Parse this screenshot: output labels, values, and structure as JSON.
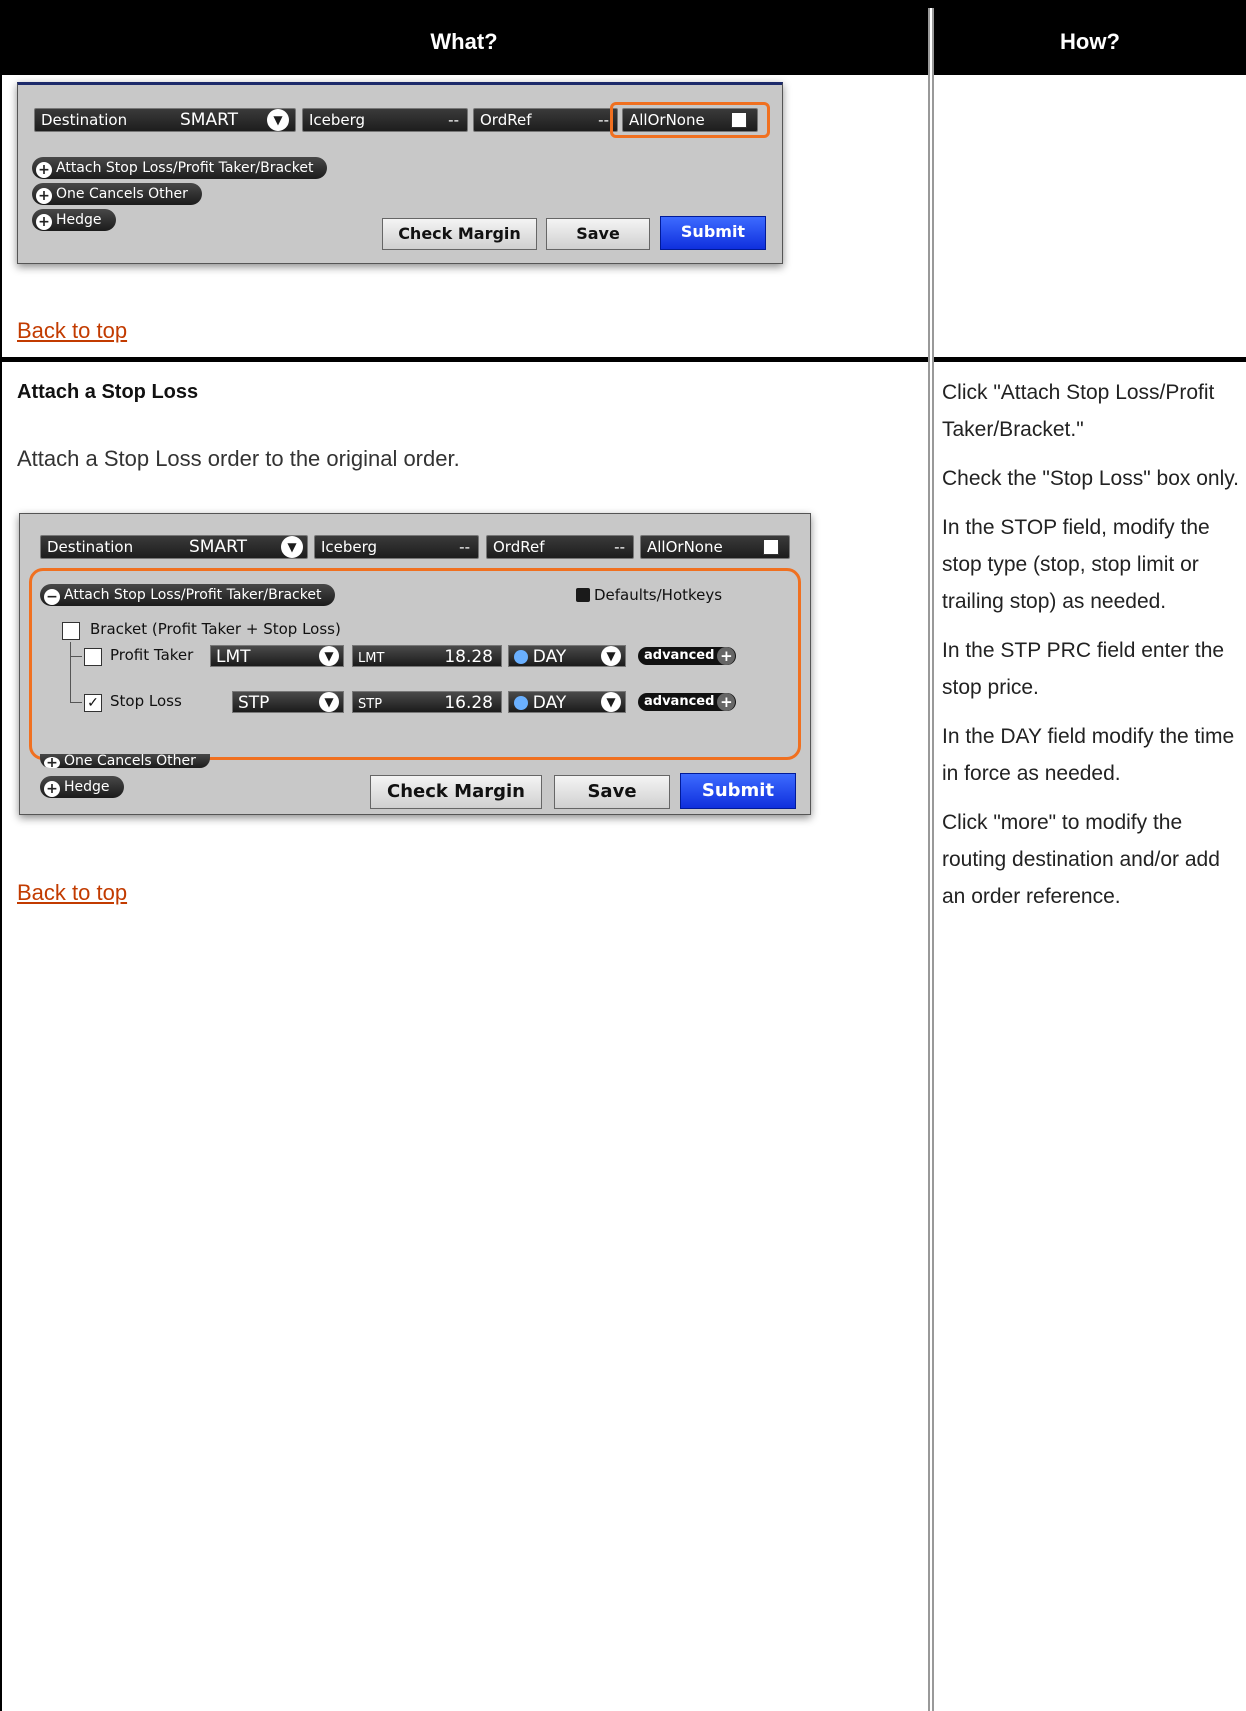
{
  "table": {
    "header_what": "What?",
    "header_how": "How?"
  },
  "section_top": {
    "back_to_top": "Back to top"
  },
  "panel1": {
    "destination_label": "Destination",
    "destination_value": "SMART",
    "iceberg_label": "Iceberg",
    "iceberg_value": "--",
    "ordref_label": "OrdRef",
    "ordref_value": "--",
    "allornone_label": "AllOrNone",
    "attach_label": "Attach Stop Loss/Profit Taker/Bracket",
    "oco_label": "One Cancels Other",
    "hedge_label": "Hedge",
    "check_margin": "Check Margin",
    "save": "Save",
    "submit": "Submit"
  },
  "section_stop": {
    "title": "Attach a Stop Loss",
    "description": "Attach a Stop Loss order to the original order.",
    "back_to_top": "Back to top"
  },
  "panel2": {
    "destination_label": "Destination",
    "destination_value": "SMART",
    "iceberg_label": "Iceberg",
    "iceberg_value": "--",
    "ordref_label": "OrdRef",
    "ordref_value": "--",
    "allornone_label": "AllOrNone",
    "attach_label": "Attach Stop Loss/Profit Taker/Bracket",
    "defaults_label": "Defaults/Hotkeys",
    "bracket_label": "Bracket (Profit Taker + Stop Loss)",
    "profit_taker_label": "Profit Taker",
    "profit_taker_type": "LMT",
    "profit_taker_price_label": "LMT",
    "profit_taker_price": "18.28",
    "profit_taker_tif": "DAY",
    "stop_loss_label": "Stop Loss",
    "stop_loss_type": "STP",
    "stop_loss_price_label": "STP",
    "stop_loss_price": "16.28",
    "stop_loss_tif": "DAY",
    "advanced_label": "advanced",
    "oco_label": "One Cancels Other",
    "hedge_label": "Hedge",
    "check_margin": "Check Margin",
    "save": "Save",
    "submit": "Submit"
  },
  "how_steps": [
    "Click \"Attach Stop Loss/Profit Taker/Bracket.\"",
    "Check the \"Stop Loss\" box only.",
    "In the STOP field, modify the stop type (stop, stop limit or trailing stop) as needed.",
    "In the STP PRC field enter the stop price.",
    "In the DAY field modify the time in force as needed.",
    "Click \"more\" to modify the routing destination and/or add an order reference."
  ],
  "colors": {
    "header_bg": "#000000",
    "link": "#c23b00",
    "highlight": "#f07020",
    "submit": "#1a3cf0"
  }
}
